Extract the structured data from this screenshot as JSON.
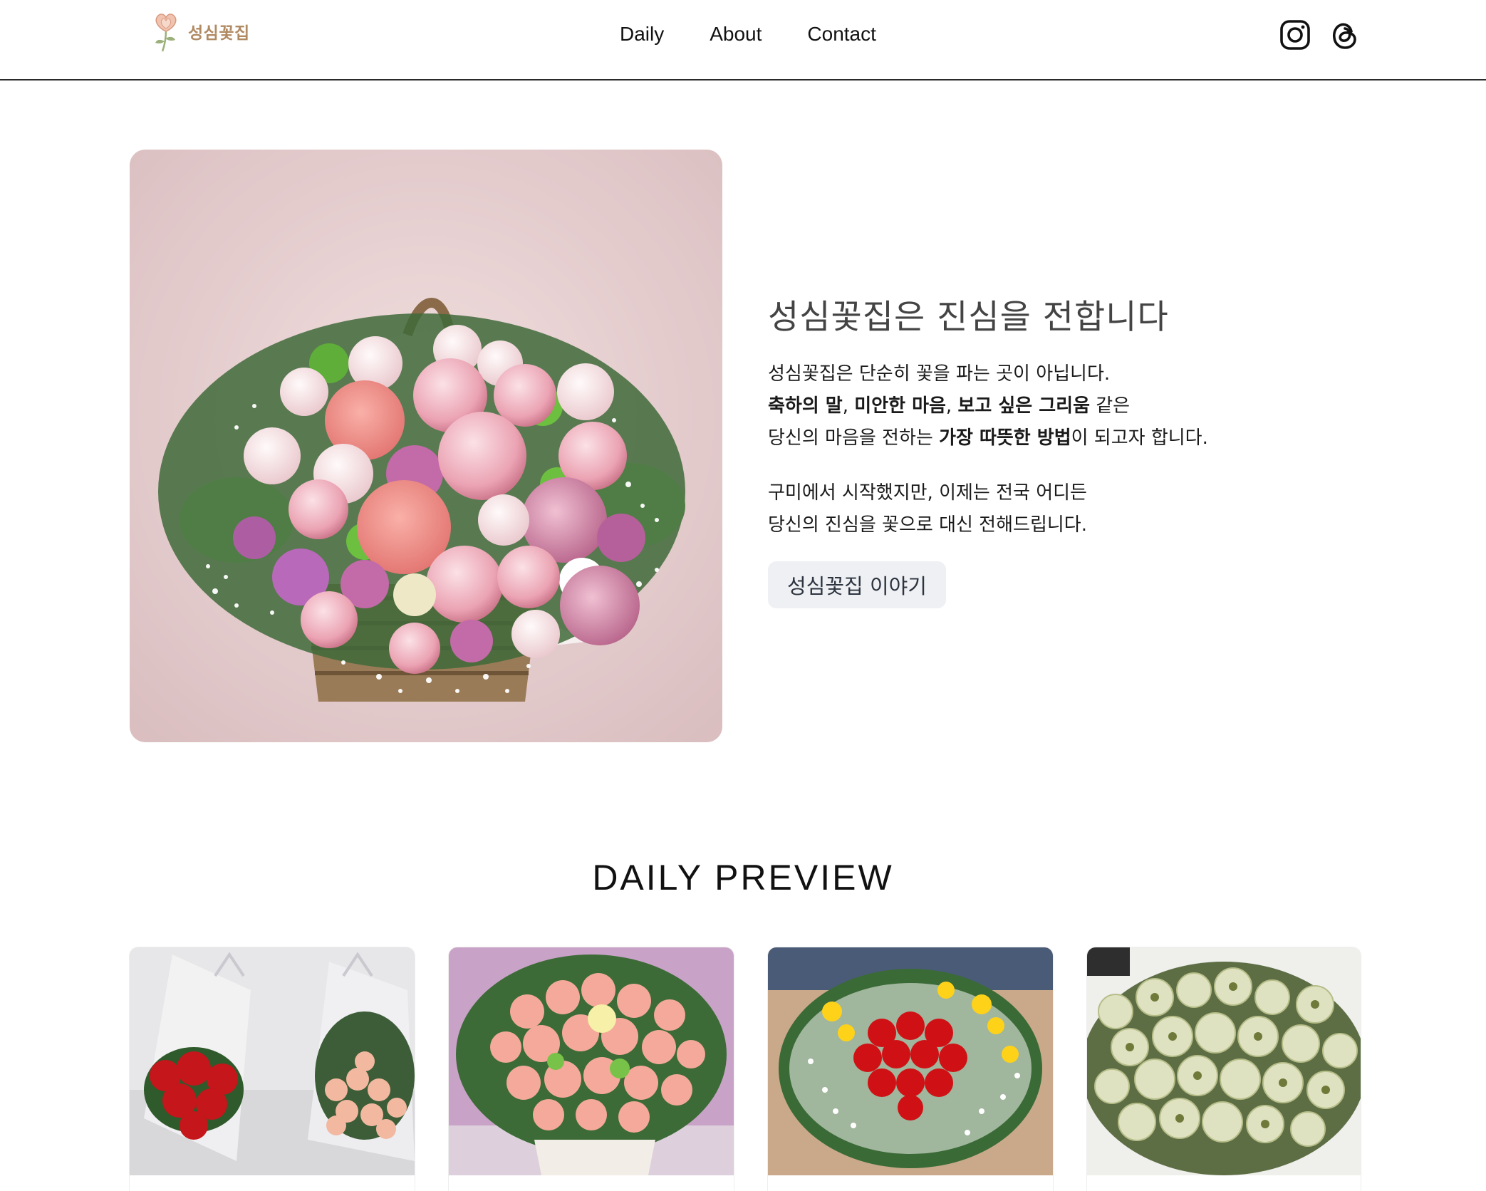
{
  "header": {
    "logo_text": "성심꽃집",
    "nav": [
      {
        "label": "Daily"
      },
      {
        "label": "About"
      },
      {
        "label": "Contact"
      }
    ],
    "social": [
      {
        "icon": "instagram-icon"
      },
      {
        "icon": "threads-icon"
      }
    ]
  },
  "hero": {
    "title": "성심꽃집은 진심을 전합니다",
    "line1": "성심꽃집은 단순히 꽃을 파는 곳이 아닙니다.",
    "line2_bold1": "축하의 말",
    "line2_sep1": ", ",
    "line2_bold2": "미안한 마음",
    "line2_sep2": ", ",
    "line2_bold3": "보고 싶은 그리움",
    "line2_tail": " 같은",
    "line3_head": "당신의 마음을 전하는 ",
    "line3_bold": "가장 따뜻한 방법",
    "line3_tail": "이 되고자 합니다.",
    "line4": "구미에서 시작했지만, 이제는 전국 어디든",
    "line5": "당신의 진심을 꽃으로 대신 전해드립니다.",
    "button_label": "성심꽃집 이야기"
  },
  "daily": {
    "title": "DAILY PREVIEW"
  },
  "colors": {
    "logo": "#b08a63",
    "button_bg": "#eef0f3",
    "divider": "#2b2b2b"
  }
}
